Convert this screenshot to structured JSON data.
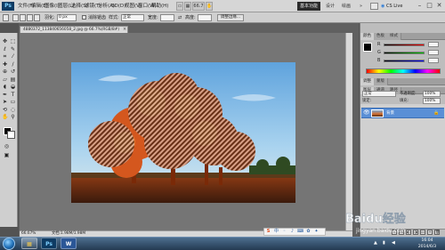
{
  "app": {
    "logo": "Ps",
    "menu": [
      "文件(F)",
      "编辑(E)",
      "图像(I)",
      "图层(L)",
      "选择(S)",
      "滤镜(T)",
      "分析(A)",
      "3D(D)",
      "视图(V)",
      "窗口(W)",
      "帮助(H)"
    ],
    "zoom_indicator": "66.7",
    "workspace": "基本功能",
    "workspace_links": [
      "设计",
      "绘画"
    ],
    "cs_live": "CS Live",
    "window_controls": [
      "–",
      "□",
      "✕"
    ]
  },
  "options_bar": {
    "feather_label": "羽化:",
    "feather_value": "0 px",
    "antialias_label": "消除锯齿",
    "style_label": "样式:",
    "style_value": "正常",
    "width_label": "宽度:",
    "height_label": "高度:",
    "refine_button": "调整边缘..."
  },
  "document": {
    "tab_title": "4880372_113840656058_2.jpg @ 66.7%(RGB/8#)",
    "status_zoom": "66.67%",
    "status_doc": "文档:1.98M/1.98M"
  },
  "panels": {
    "color_tabs": [
      "颜色",
      "色板",
      "样式"
    ],
    "color_slider_labels": [
      "R",
      "G",
      "B"
    ],
    "adjust_tabs": [
      "调整",
      "蒙版"
    ],
    "layer_tabs": [
      "图层",
      "通道",
      "路径"
    ],
    "blend_mode": "正常",
    "opacity_label": "不透明度:",
    "opacity_value": "100%",
    "lock_label": "锁定:",
    "fill_label": "填充:",
    "fill_value": "100%",
    "layer_name": "背景"
  },
  "taskbar": {
    "apps": [
      "Ps",
      "W"
    ],
    "time": "16:04",
    "date": "2014/6/3"
  },
  "watermark": {
    "brand": "Baidu经验",
    "url": "jingyan.baidu.com"
  },
  "colors": {
    "accent_layer": "#5a8fd6",
    "workspace_btn": "#2b2b2b",
    "ps_blue": "#0e3b63"
  }
}
